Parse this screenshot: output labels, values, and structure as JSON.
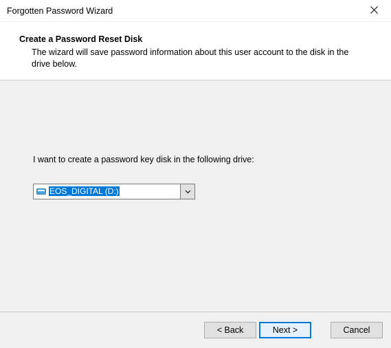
{
  "titlebar": {
    "title": "Forgotten Password Wizard"
  },
  "header": {
    "title": "Create a Password Reset Disk",
    "description": "The wizard will save password information about this user account to the disk in the drive below."
  },
  "content": {
    "prompt": "I want to create a password key disk in the following drive:",
    "selected_drive": "EOS_DIGITAL (D:)"
  },
  "footer": {
    "back_label": "< Back",
    "next_label": "Next >",
    "cancel_label": "Cancel"
  }
}
